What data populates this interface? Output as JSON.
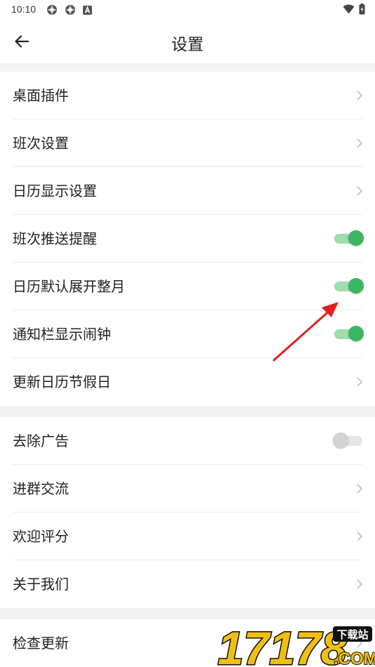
{
  "status_bar": {
    "time": "10:10"
  },
  "app_bar": {
    "title": "设置"
  },
  "group1": [
    {
      "label": "桌面插件",
      "control": "chevron"
    },
    {
      "label": "班次设置",
      "control": "chevron"
    },
    {
      "label": "日历显示设置",
      "control": "chevron"
    },
    {
      "label": "班次推送提醒",
      "control": "toggle",
      "on": true
    },
    {
      "label": "日历默认展开整月",
      "control": "toggle",
      "on": true
    },
    {
      "label": "通知栏显示闹钟",
      "control": "toggle",
      "on": true
    },
    {
      "label": "更新日历节假日",
      "control": "chevron"
    }
  ],
  "group2": [
    {
      "label": "去除广告",
      "control": "toggle",
      "on": false
    },
    {
      "label": "进群交流",
      "control": "chevron"
    },
    {
      "label": "欢迎评分",
      "control": "chevron"
    },
    {
      "label": "关于我们",
      "control": "chevron"
    }
  ],
  "group3": [
    {
      "label": "检查更新",
      "control": "chevron"
    }
  ],
  "watermark": {
    "brand": "17178",
    "tag": "下载站",
    "suffix": ".COM"
  },
  "colors": {
    "toggle_on_thumb": "#3cb661",
    "toggle_on_track": "#9fdcb1",
    "toggle_off_thumb": "#d3d3d3",
    "annotation_arrow": "#e02020"
  }
}
